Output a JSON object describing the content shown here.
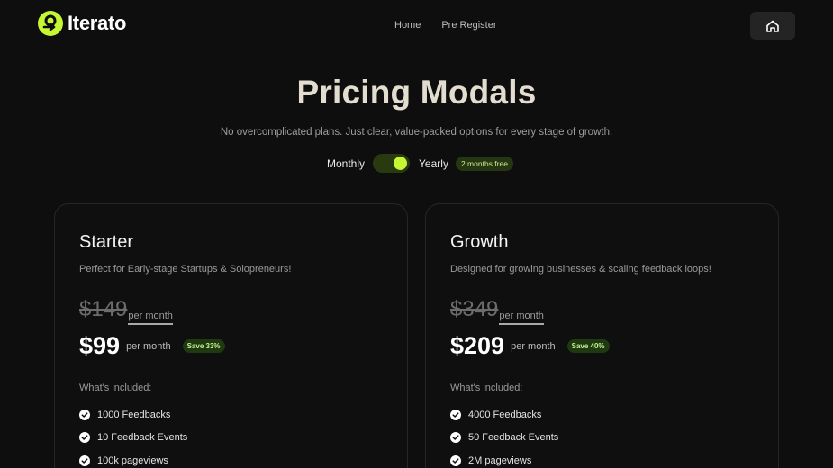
{
  "brand": {
    "name": "Iterato",
    "accent_color": "#c6f733"
  },
  "nav": {
    "links": [
      "Home",
      "Pre Register"
    ],
    "home_icon": "home-icon"
  },
  "hero": {
    "title": "Pricing Modals",
    "subtitle": "No overcomplicated plans. Just clear, value-packed options for every stage of growth."
  },
  "billing_toggle": {
    "left_label": "Monthly",
    "right_label": "Yearly",
    "badge": "2 months free",
    "selected": "Yearly"
  },
  "plans": [
    {
      "name": "Starter",
      "description": "Perfect for Early-stage Startups & Solopreneurs!",
      "old_price": "$149",
      "old_per": "per month",
      "price": "$99",
      "per": "per month",
      "save_badge": "Save 33%",
      "included_label": "What's included:",
      "features": [
        "1000 Feedbacks",
        "10 Feedback Events",
        "100k pageviews"
      ]
    },
    {
      "name": "Growth",
      "description": "Designed for growing businesses & scaling feedback loops!",
      "old_price": "$349",
      "old_per": "per month",
      "price": "$209",
      "per": "per month",
      "save_badge": "Save 40%",
      "included_label": "What's included:",
      "features": [
        "4000 Feedbacks",
        "50 Feedback Events",
        "2M pageviews"
      ]
    }
  ]
}
